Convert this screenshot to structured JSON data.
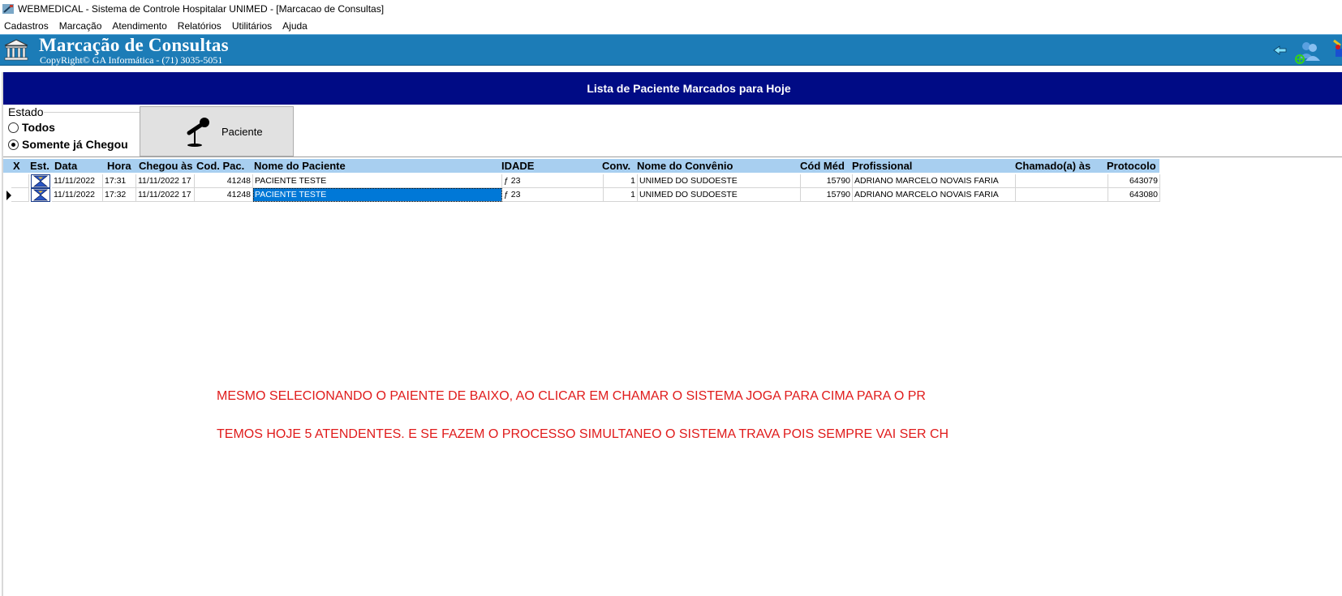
{
  "window": {
    "title": "WEBMEDICAL - Sistema de Controle Hospitalar UNIMED - [Marcacao de Consultas]"
  },
  "menu": [
    "Cadastros",
    "Marcação",
    "Atendimento",
    "Relatórios",
    "Utilitários",
    "Ajuda"
  ],
  "banner": {
    "title": "Marcação de Consultas",
    "subtitle": "CopyRight© GA Informática - (71) 3035-5051",
    "color": "#1c7cb7"
  },
  "list_header": "Lista de Paciente Marcados para Hoje",
  "estado": {
    "legend": "Estado",
    "options": [
      {
        "label": "Todos",
        "checked": false
      },
      {
        "label": "Somente já Chegou",
        "checked": true
      }
    ]
  },
  "paciente_button": {
    "label": "Paciente",
    "icon": "microphone-icon"
  },
  "grid": {
    "columns": [
      "X",
      "Est.",
      "Data",
      "Hora",
      "Chegou às",
      "Cod. Pac.",
      "Nome do Paciente",
      "IDADE",
      "Conv.",
      "Nome do Convênio",
      "Cód Méd",
      "Profissional",
      "Chamado(a) às",
      "Protocolo"
    ],
    "rows": [
      {
        "x": "",
        "data": "11/11/2022",
        "hora": "17:31",
        "chegou": "11/11/2022 17",
        "cod_pac": "41248",
        "nome": "PACIENTE TESTE",
        "idade": "ƒ 23",
        "conv": "1",
        "convenio": "UNIMED DO SUDOESTE",
        "cod_med": "15790",
        "profissional": "ADRIANO MARCELO NOVAIS FARIA",
        "chamado": "",
        "protocolo": "643079"
      },
      {
        "x": "",
        "data": "11/11/2022",
        "hora": "17:32",
        "chegou": "11/11/2022 17",
        "cod_pac": "41248",
        "nome": "PACIENTE TESTE",
        "idade": "ƒ 23",
        "conv": "1",
        "convenio": "UNIMED DO SUDOESTE",
        "cod_med": "15790",
        "profissional": "ADRIANO MARCELO NOVAIS FARIA",
        "chamado": "",
        "protocolo": "643080"
      }
    ],
    "selected_row": 1
  },
  "annotations": [
    "MESMO SELECIONANDO O PAIENTE DE BAIXO, AO CLICAR EM CHAMAR O SISTEMA JOGA PARA CIMA PARA O PR",
    "TEMOS HOJE 5 ATENDENTES. E SE FAZEM O PROCESSO SIMULTANEO O SISTEMA TRAVA POIS SEMPRE VAI SER CH"
  ],
  "colors": {
    "list_header_bg": "#000b85",
    "grid_header_bg": "#a8cff0",
    "selection": "#0078d7",
    "annotation": "#e01b1b"
  }
}
